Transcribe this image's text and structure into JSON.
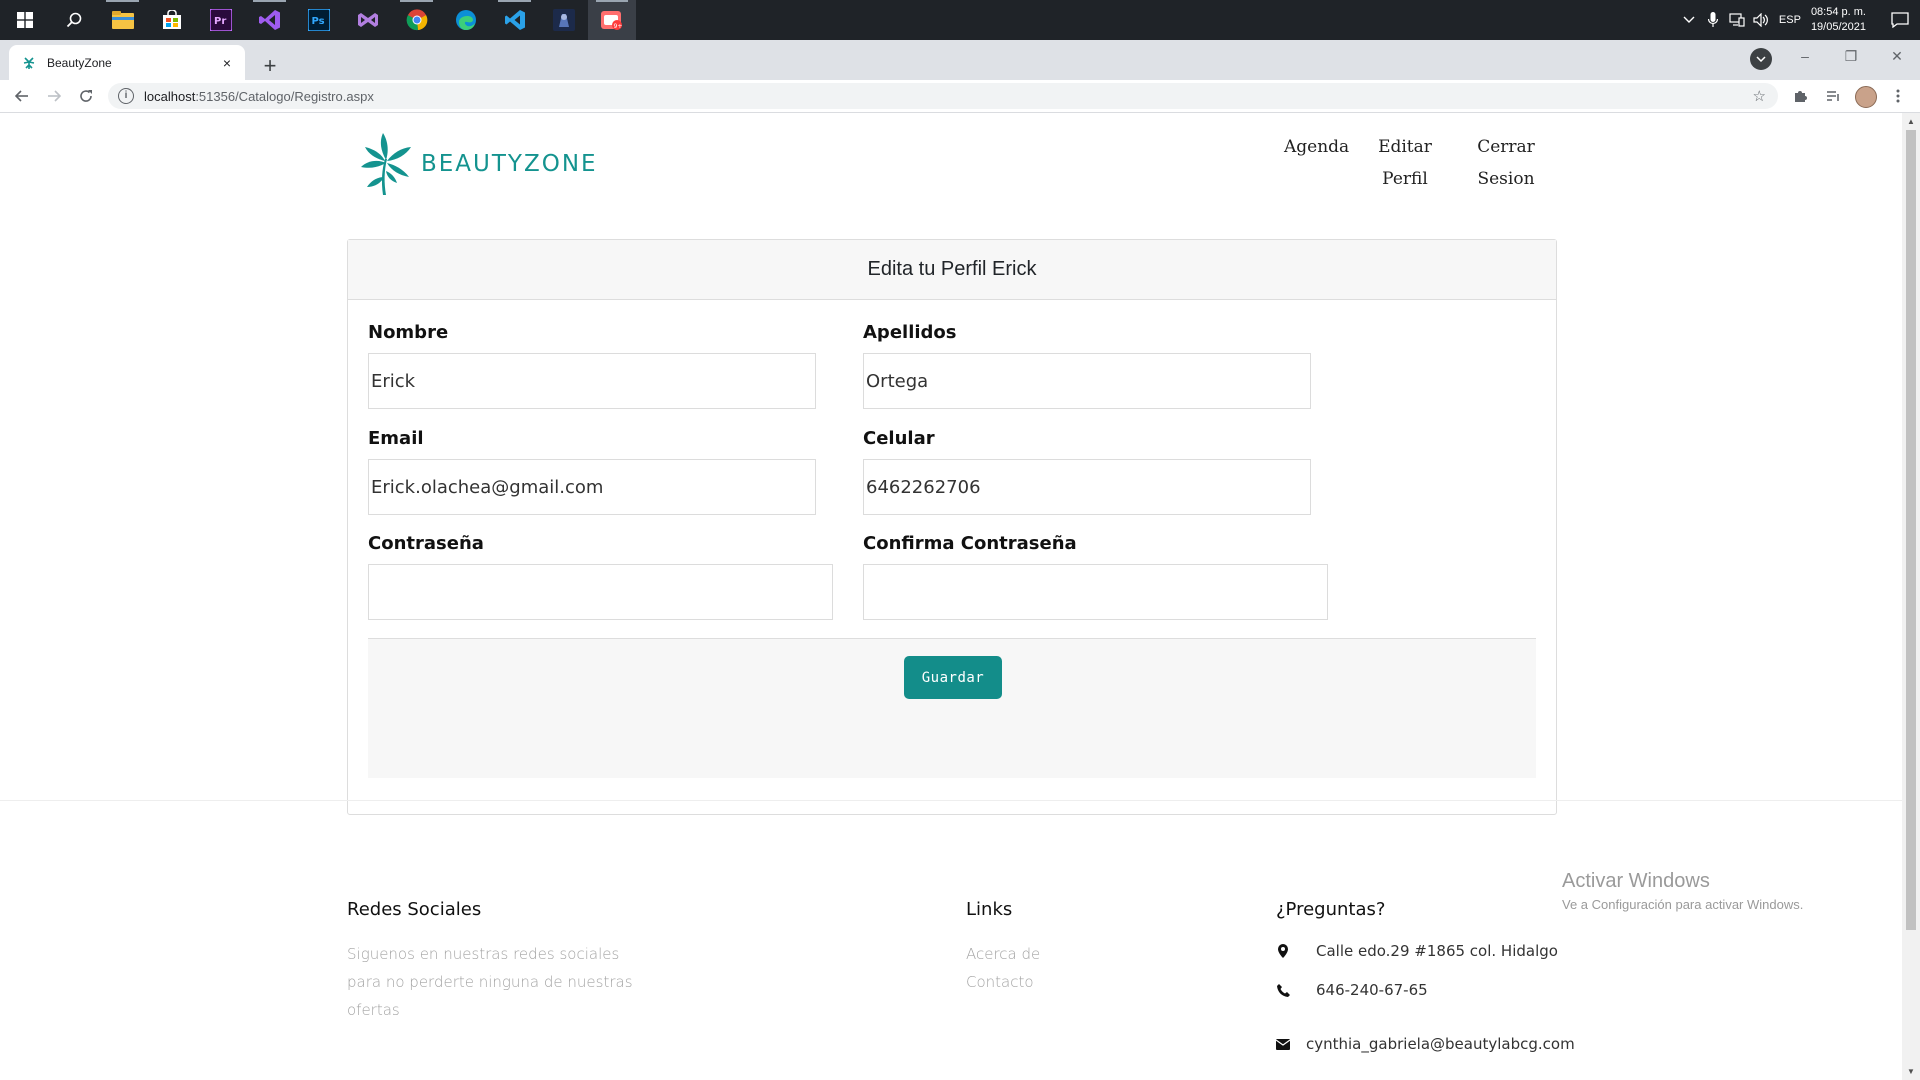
{
  "browser": {
    "tab_title": "BeautyZone",
    "tab_close": "×",
    "new_tab": "+",
    "url_host": "localhost",
    "url_path": ":51356/Catalogo/Registro.aspx",
    "window_controls": {
      "minimize": "–",
      "restore": "❐",
      "close": "✕"
    }
  },
  "taskbar": {
    "apps": [
      "start-icon",
      "search-icon",
      "file-explorer-icon",
      "store-icon",
      "premiere-icon",
      "visual-studio-icon",
      "photoshop-icon",
      "visual-studio-alt-icon",
      "chrome-icon",
      "edge-icon",
      "vscode-icon",
      "game-icon",
      "active-app-icon"
    ],
    "language": "ESP",
    "time": "08:54 p. m.",
    "date": "19/05/2021"
  },
  "header": {
    "brand": "BEAUTYZONE",
    "nav": {
      "agenda": "Agenda",
      "editar_line1": "Editar",
      "editar_line2": "Perfil",
      "cerrar_line1": "Cerrar",
      "cerrar_line2": "Sesion"
    }
  },
  "form": {
    "title": "Edita tu Perfil Erick",
    "fields": {
      "nombre": {
        "label": "Nombre",
        "value": "Erick"
      },
      "apellidos": {
        "label": "Apellidos",
        "value": "Ortega"
      },
      "email": {
        "label": "Email",
        "value": "Erick.olachea@gmail.com"
      },
      "celular": {
        "label": "Celular",
        "value": "6462262706"
      },
      "contrasena": {
        "label": "Contraseña",
        "value": ""
      },
      "confirma": {
        "label": "Confirma Contraseña",
        "value": ""
      }
    },
    "save_label": "Guardar"
  },
  "footer": {
    "social": {
      "heading": "Redes Sociales",
      "line1": "Siguenos en nuestras redes sociales",
      "line2": "para no perderte ninguna de nuestras",
      "line3": "ofertas"
    },
    "links": {
      "heading": "Links",
      "acerca": "Acerca de",
      "contacto": "Contacto"
    },
    "questions": {
      "heading": "¿Preguntas?",
      "address": "Calle edo.29 #1865 col. Hidalgo",
      "phone": "646-240-67-65",
      "email": "cynthia_gabriela@beautylabcg.com"
    }
  },
  "watermark": {
    "title": "Activar Windows",
    "subtitle": "Ve a Configuración para activar Windows."
  },
  "colors": {
    "accent": "#138d8a",
    "brand": "#14938f"
  }
}
